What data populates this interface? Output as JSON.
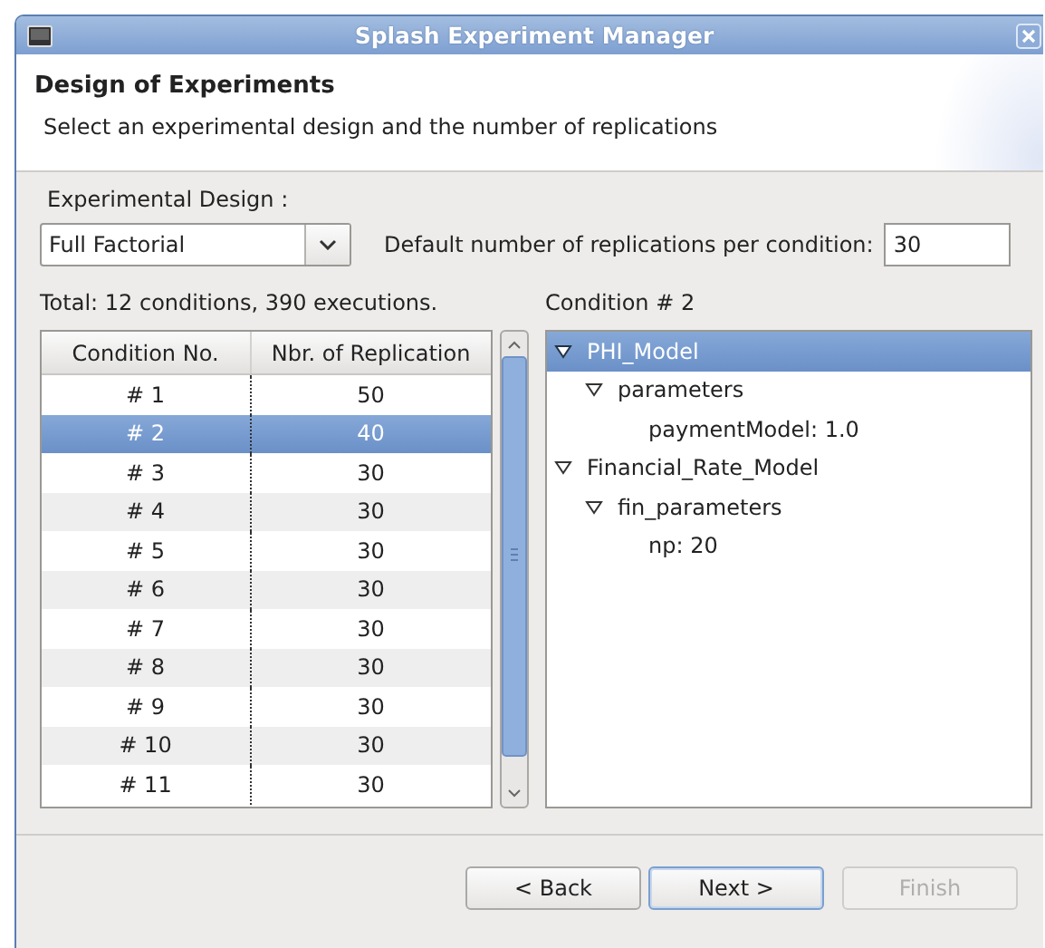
{
  "window": {
    "title": "Splash Experiment Manager"
  },
  "header": {
    "title": "Design of Experiments",
    "description": "Select an experimental design and the number of replications"
  },
  "design": {
    "label": "Experimental Design :",
    "value": "Full Factorial"
  },
  "replications": {
    "label": "Default number of replications per condition:",
    "value": "30"
  },
  "summary": "Total: 12 conditions, 390 executions.",
  "table": {
    "columns": [
      "Condition No.",
      "Nbr. of Replication"
    ],
    "rows": [
      {
        "cells": [
          "# 1",
          "50"
        ],
        "selected": false
      },
      {
        "cells": [
          "# 2",
          "40"
        ],
        "selected": true
      },
      {
        "cells": [
          "# 3",
          "30"
        ],
        "selected": false
      },
      {
        "cells": [
          "# 4",
          "30"
        ],
        "selected": false
      },
      {
        "cells": [
          "# 5",
          "30"
        ],
        "selected": false
      },
      {
        "cells": [
          "# 6",
          "30"
        ],
        "selected": false
      },
      {
        "cells": [
          "# 7",
          "30"
        ],
        "selected": false
      },
      {
        "cells": [
          "# 8",
          "30"
        ],
        "selected": false
      },
      {
        "cells": [
          "# 9",
          "30"
        ],
        "selected": false
      },
      {
        "cells": [
          "# 10",
          "30"
        ],
        "selected": false
      },
      {
        "cells": [
          "# 11",
          "30"
        ],
        "selected": false
      }
    ]
  },
  "condition_title": "Condition # 2",
  "tree": [
    {
      "label": "PHI_Model",
      "expanded": true,
      "selected": true,
      "children": [
        {
          "label": "parameters",
          "expanded": true,
          "selected": false,
          "children": [
            {
              "label": "paymentModel: 1.0",
              "selected": false
            }
          ]
        }
      ]
    },
    {
      "label": "Financial_Rate_Model",
      "expanded": true,
      "selected": false,
      "children": [
        {
          "label": "fin_parameters",
          "expanded": true,
          "selected": false,
          "children": [
            {
              "label": "np: 20",
              "selected": false
            }
          ]
        }
      ]
    }
  ],
  "buttons": [
    {
      "label": "< Back",
      "disabled": false,
      "focused": false
    },
    {
      "label": "Next >",
      "disabled": false,
      "focused": true
    },
    {
      "label": "Finish",
      "disabled": true,
      "focused": false
    }
  ]
}
